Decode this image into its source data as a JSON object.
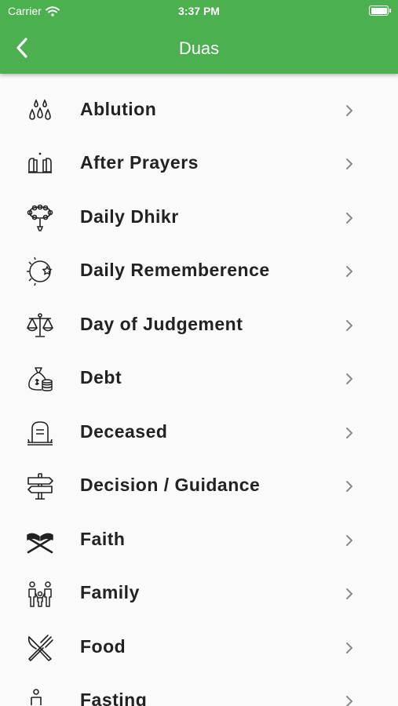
{
  "status_bar": {
    "carrier": "Carrier",
    "time": "3:37 PM"
  },
  "header": {
    "title": "Duas",
    "back_icon": "chevron-left-icon",
    "color": "#4caf50"
  },
  "items": [
    {
      "label": "Ablution",
      "icon": "water-drops-icon"
    },
    {
      "label": "After Prayers",
      "icon": "praying-hands-icon"
    },
    {
      "label": "Daily Dhikr",
      "icon": "prayer-beads-icon"
    },
    {
      "label": "Daily Rememberence",
      "icon": "sun-moon-icon"
    },
    {
      "label": "Day of Judgement",
      "icon": "scales-icon"
    },
    {
      "label": "Debt",
      "icon": "money-bag-icon"
    },
    {
      "label": "Deceased",
      "icon": "gravestone-icon"
    },
    {
      "label": "Decision / Guidance",
      "icon": "signpost-icon"
    },
    {
      "label": "Faith",
      "icon": "quran-stand-icon"
    },
    {
      "label": "Family",
      "icon": "family-icon"
    },
    {
      "label": "Food",
      "icon": "fork-knife-icon"
    },
    {
      "label": "Fasting",
      "icon": "person-icon"
    }
  ]
}
